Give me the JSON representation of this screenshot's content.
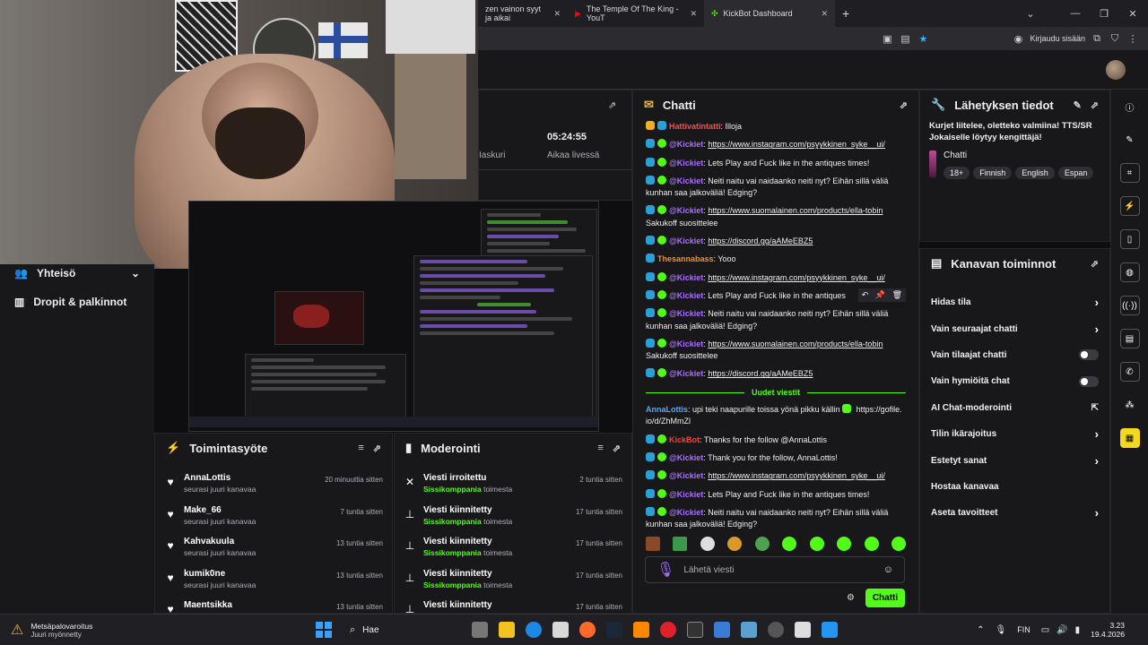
{
  "browser": {
    "tabs": [
      {
        "label": "zen vainon syyt ja aikai",
        "active": false
      },
      {
        "label": "The Temple Of The King - YouT",
        "active": false
      },
      {
        "label": "KickBot Dashboard",
        "active": true
      }
    ],
    "new_tab": "+",
    "signin": "Kirjaudu sisään"
  },
  "leftnav": {
    "items": [
      {
        "label": "Yhteisö",
        "chevron": "⌄"
      },
      {
        "label": "Dropit & palkinnot"
      }
    ]
  },
  "stats": {
    "left_label": "Iaskuri",
    "time_value": "05:24:55",
    "time_label": "Aikaa livessä"
  },
  "chat": {
    "title": "Chatti",
    "messages": [
      {
        "user": "Hattivatintatti",
        "text": ": Illoja",
        "color": "#ff4b4b"
      },
      {
        "user": "@Kickiet",
        "link": "https://www.instagram.com/psyykkinen_syke__ui/"
      },
      {
        "user": "@Kickiet",
        "text": ": Lets Play and Fuck like in the antiques times!"
      },
      {
        "user": "@Kickiet",
        "text": ": Neiti naitu vai naidaanko neiti nyt? Eihän sillä väliä kunhan saa jalkoväliä! Edging?"
      },
      {
        "user": "@Kickiet",
        "link": "https://www.suomalainen.com/products/ella-tobin",
        "after": " Sakukoff suosittelee"
      },
      {
        "user": "@Kickiet",
        "link": "https://discord.gg/aAMeEBZ5"
      },
      {
        "user": "Thesannabass",
        "text": ": Yooo",
        "color": "#ff8c1a"
      },
      {
        "user": "@Kickiet",
        "link": "https://www.instagram.com/psyykkinen_syke__ui/"
      },
      {
        "user": "@Kickiet",
        "text": ": Lets Play and Fuck like in the antiques"
      },
      {
        "user": "@Kickiet",
        "text": ": Neiti naitu vai naidaanko neiti nyt? Eihän sillä väliä kunhan saa jalkoväliä! Edging?"
      },
      {
        "user": "@Kickiet",
        "link": "https://www.suomalainen.com/products/ella-tobin",
        "after": " Sakukoff suosittelee"
      },
      {
        "user": "@Kickiet",
        "link": "https://discord.gg/aAMeEBZ5"
      }
    ],
    "new_messages_label": "Uudet viestit",
    "new_messages": [
      {
        "user": "AnnaLottis",
        "text": ": upi teki naapurille toissa yönä pikku källin",
        "link": "https://gofile. io/d/ZhMmZl",
        "color": "#53a8ff",
        "badges": false
      },
      {
        "user": "KickBot",
        "text": ": Thanks for the follow @AnnaLottis",
        "color": "#ff3b3b"
      },
      {
        "user": "@Kickiet",
        "text": ": Thank you for the follow, AnnaLottis!"
      },
      {
        "user": "@Kickiet",
        "link": "https://www.instagram.com/psyykkinen_syke__ui/"
      },
      {
        "user": "@Kickiet",
        "text": ": Lets Play and Fuck like in the antiques times!"
      },
      {
        "user": "@Kickiet",
        "text": ": Neiti naitu vai naidaanko neiti nyt? Eihän sillä väliä kunhan saa jalkoväliä! Edging?"
      }
    ],
    "input_placeholder": "Lähetä viesti",
    "send_label": "Chatti"
  },
  "stream_info": {
    "title": "Lähetyksen tiedot",
    "description": "Kurjet liitelee, oletteko valmiina! TTS/SR Jokaiselle löytyy kengittäjä!",
    "category": "Chatti",
    "tags": [
      "18+",
      "Finnish",
      "English",
      "Espan"
    ]
  },
  "channel_actions": {
    "title": "Kanavan toiminnot",
    "rows": [
      {
        "label": "Hidas tila",
        "control": "chevron"
      },
      {
        "label": "Vain seuraajat chatti",
        "control": "chevron"
      },
      {
        "label": "Vain tilaajat chatti",
        "control": "toggle"
      },
      {
        "label": "Vain hymiöitä chat",
        "control": "toggle"
      },
      {
        "label": "AI Chat-moderointi",
        "control": "link"
      },
      {
        "label": "Tilin ikärajoitus",
        "control": "chevron"
      },
      {
        "label": "Estetyt sanat",
        "control": "chevron"
      },
      {
        "label": "Hostaa kanavaa",
        "control": "none"
      },
      {
        "label": "Aseta tavoitteet",
        "control": "chevron"
      }
    ]
  },
  "activity": {
    "title": "Toimintasyöte",
    "rows": [
      {
        "name": "AnnaLottis",
        "sub": "seurasi juuri kanavaa",
        "time": "20 minuuttia sitten"
      },
      {
        "name": "Make_66",
        "sub": "seurasi juuri kanavaa",
        "time": "7 tuntia sitten"
      },
      {
        "name": "Kahvakuula",
        "sub": "seurasi juuri kanavaa",
        "time": "13 tuntia sitten"
      },
      {
        "name": "kumik0ne",
        "sub": "seurasi juuri kanavaa",
        "time": "13 tuntia sitten"
      },
      {
        "name": "Maentsikka",
        "sub": "",
        "time": "13 tuntia sitten"
      }
    ]
  },
  "moderation": {
    "title": "Moderointi",
    "rows": [
      {
        "title": "Viesti irroitettu",
        "user": "Sissikomppania",
        "sub": " toimesta",
        "time": "2 tuntia sitten"
      },
      {
        "title": "Viesti kiinnitetty",
        "user": "Sissikomppania",
        "sub": " toimesta",
        "time": "17 tuntia sitten"
      },
      {
        "title": "Viesti kiinnitetty",
        "user": "Sissikomppania",
        "sub": " toimesta",
        "time": "17 tuntia sitten"
      },
      {
        "title": "Viesti kiinnitetty",
        "user": "Sissikomppania",
        "sub": " toimesta",
        "time": "17 tuntia sitten"
      },
      {
        "title": "Viesti kiinnitetty",
        "user": "",
        "sub": "",
        "time": "17 tuntia sitten"
      }
    ]
  },
  "taskbar": {
    "notif_title": "Metsäpalovaroitus",
    "notif_sub": "Juuri myönnetty",
    "search": "Hae",
    "lang": "FIN",
    "time": "3.23",
    "date": "19.4.2026"
  },
  "colors": {
    "accent": "#53fc18",
    "bg": "#0e0e10",
    "panel": "#18181b"
  }
}
